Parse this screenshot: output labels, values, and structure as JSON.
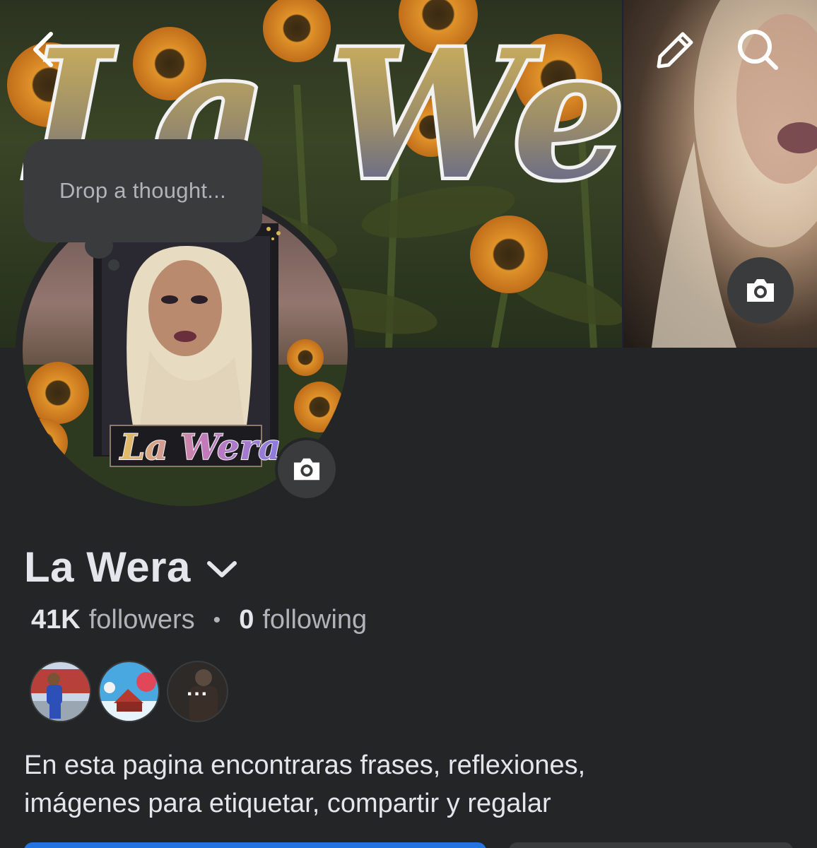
{
  "header": {
    "back_icon": "chevron-left-icon",
    "edit_icon": "pencil-icon",
    "search_icon": "search-icon"
  },
  "cover": {
    "logo_text": "La Wera",
    "camera_icon": "camera-icon"
  },
  "avatar": {
    "logo_text": "La Wera",
    "camera_icon": "camera-icon"
  },
  "thought": {
    "placeholder": "Drop a thought..."
  },
  "profile": {
    "name": "La Wera",
    "followers_count": "41K",
    "followers_label": "followers",
    "separator": "•",
    "following_count": "0",
    "following_label": "following",
    "bio_line1": "En esta pagina encontraras frases, reflexiones,",
    "bio_line2": "imágenes para etiquetar, compartir y regalar"
  },
  "friends": {
    "more_label": "..."
  },
  "colors": {
    "background": "#242526",
    "surface": "#3a3b3c",
    "primary_text": "#e4e6eb",
    "secondary_text": "#b0b3b8",
    "accent_blue": "#2374e1"
  }
}
